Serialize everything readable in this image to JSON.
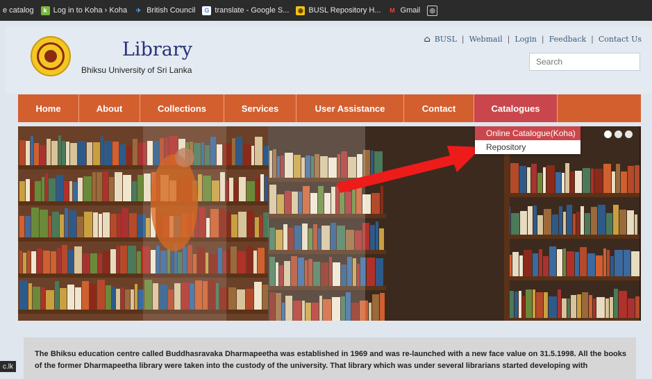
{
  "bookmarks": [
    {
      "label": "e catalog",
      "icon": "none"
    },
    {
      "label": "Log in to Koha › Koha",
      "icon": "koha-icon",
      "glyph": "k"
    },
    {
      "label": "British Council",
      "icon": "british-council-icon",
      "glyph": "✈"
    },
    {
      "label": "translate - Google S...",
      "icon": "google-icon",
      "glyph": "G"
    },
    {
      "label": "BUSL Repository H...",
      "icon": "busl-icon",
      "glyph": "◉"
    },
    {
      "label": "Gmail",
      "icon": "gmail-icon",
      "glyph": "M"
    },
    {
      "label": "",
      "icon": "globe-icon",
      "glyph": "◎"
    }
  ],
  "header": {
    "title": "Library",
    "subtitle": "Bhiksu University of Sri Lanka",
    "links": [
      "BUSL",
      "Webmail",
      "Login",
      "Feedback",
      "Contact Us"
    ],
    "search_placeholder": "Search"
  },
  "nav": [
    {
      "label": "Home",
      "w": 88
    },
    {
      "label": "About",
      "w": 88
    },
    {
      "label": "Collections",
      "w": 121
    },
    {
      "label": "Services",
      "w": 104
    },
    {
      "label": "User Assistance",
      "w": 155
    },
    {
      "label": "Contact",
      "w": 101
    },
    {
      "label": "Catalogues",
      "w": 120,
      "active": true
    }
  ],
  "dropdown": [
    "Online Catalogue(Koha)",
    "Repository"
  ],
  "intro_text": "The Bhiksu education centre called Buddhasravaka Dharmapeetha was established in 1969 and was re-launched with a new face value on 31.5.1998. All the books of the former Dharmapeetha library were taken into the custody of the university. That library which was under several librarians started developing with",
  "status_tab": "c.lk",
  "colors": {
    "nav": "#d35f2f",
    "active": "#c9474c",
    "title": "#27327a",
    "arrow": "#ee1b1b"
  }
}
